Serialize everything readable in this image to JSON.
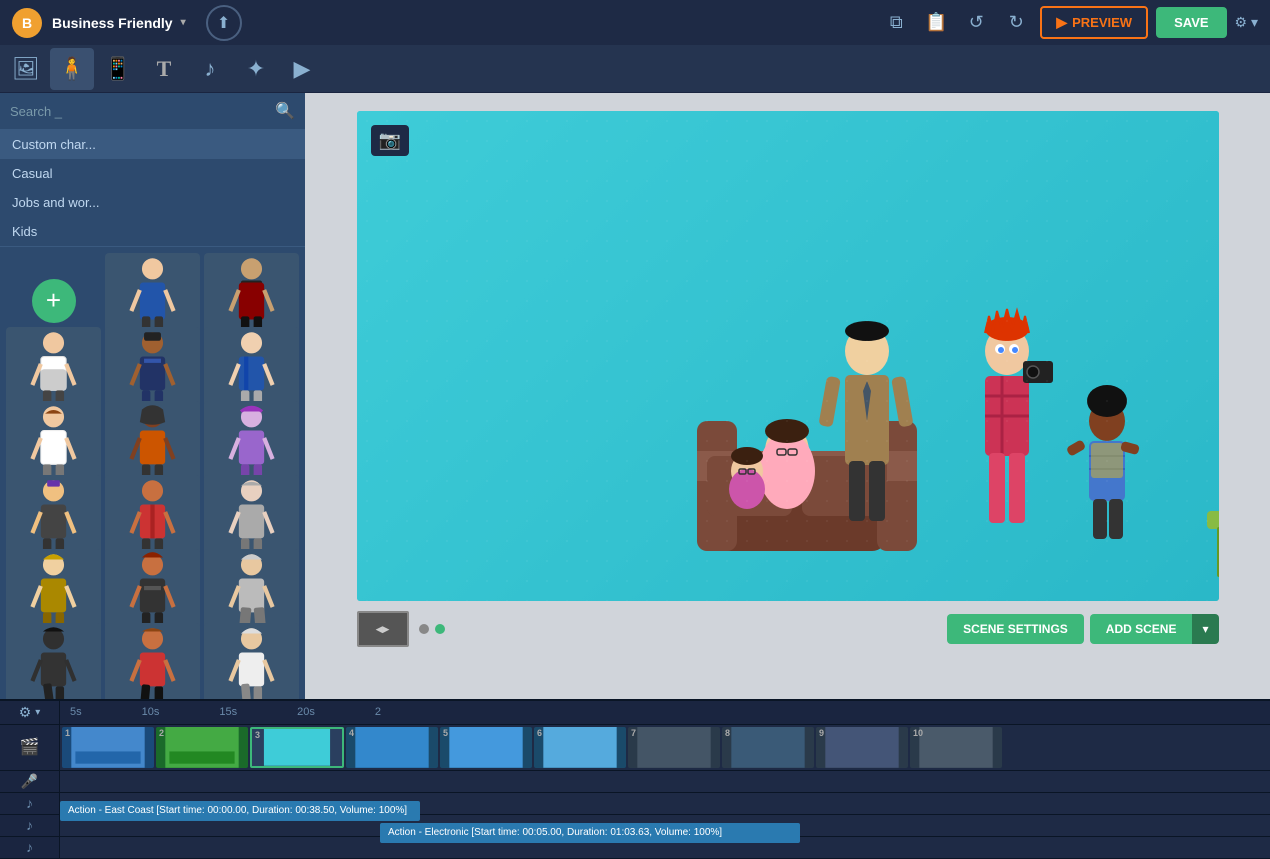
{
  "app": {
    "title": "Business Friendly",
    "preview_label": "PREVIEW",
    "save_label": "SAVE"
  },
  "toolbar": {
    "tools": [
      {
        "id": "image",
        "icon": "🖼",
        "active": false
      },
      {
        "id": "character",
        "icon": "👤",
        "active": true
      },
      {
        "id": "device",
        "icon": "📱",
        "active": false
      },
      {
        "id": "text",
        "icon": "T",
        "active": false
      },
      {
        "id": "music",
        "icon": "♪",
        "active": false
      },
      {
        "id": "effects",
        "icon": "✦",
        "active": false
      },
      {
        "id": "video",
        "icon": "▶",
        "active": false
      }
    ]
  },
  "sidebar": {
    "search_placeholder": "Search _",
    "categories": [
      {
        "id": "custom",
        "label": "Custom char..."
      },
      {
        "id": "casual",
        "label": "Casual"
      },
      {
        "id": "jobs",
        "label": "Jobs and wor..."
      },
      {
        "id": "kids",
        "label": "Kids"
      }
    ]
  },
  "canvas": {
    "scene_settings_label": "SCENE SETTINGS",
    "add_scene_label": "ADD SCENE"
  },
  "timeline": {
    "ruler_marks": [
      "5s",
      "10s",
      "15s",
      "20s",
      "2"
    ],
    "audio_tracks": [
      {
        "label": "Action - East Coast [Start time: 00:00.00, Duration: 00:38.50, Volume: 100%]"
      },
      {
        "label": "Action - Electronic [Start time: 00:05.00, Duration: 01:03.63, Volume: 100%]"
      }
    ],
    "scenes": [
      {
        "num": "1"
      },
      {
        "num": "2"
      },
      {
        "num": "3"
      },
      {
        "num": "4"
      },
      {
        "num": "5"
      },
      {
        "num": "6"
      },
      {
        "num": "7"
      },
      {
        "num": "8"
      },
      {
        "num": "9"
      },
      {
        "num": "10"
      }
    ]
  }
}
